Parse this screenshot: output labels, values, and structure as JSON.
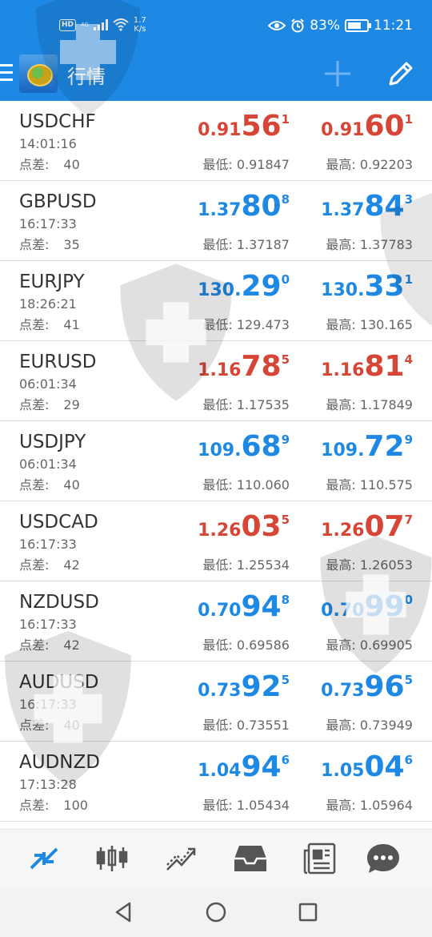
{
  "status_bar": {
    "hd": "HD",
    "network": "4G",
    "speed": "1.7",
    "speed_unit": "K/s",
    "battery": "83%",
    "time": "11:21"
  },
  "app_bar": {
    "title": "行情",
    "menu_icon": "menu-icon",
    "add_icon": "plus-icon",
    "edit_icon": "pencil-icon"
  },
  "quotes": [
    {
      "symbol": "USDCHF",
      "time": "14:01:16",
      "spread_label": "点差:",
      "spread": "40",
      "color": "red",
      "bid": {
        "pre": "0.91",
        "big": "56",
        "sup": "1"
      },
      "ask": {
        "pre": "0.91",
        "big": "60",
        "sup": "1"
      },
      "low": "最低: 0.91847",
      "high": "最高: 0.92203"
    },
    {
      "symbol": "GBPUSD",
      "time": "16:17:33",
      "spread_label": "点差:",
      "spread": "35",
      "color": "blue",
      "bid": {
        "pre": "1.37",
        "big": "80",
        "sup": "8"
      },
      "ask": {
        "pre": "1.37",
        "big": "84",
        "sup": "3"
      },
      "low": "最低: 1.37187",
      "high": "最高: 1.37783"
    },
    {
      "symbol": "EURJPY",
      "time": "18:26:21",
      "spread_label": "点差:",
      "spread": "41",
      "color": "blue",
      "bid": {
        "pre": "130.",
        "big": "29",
        "sup": "0"
      },
      "ask": {
        "pre": "130.",
        "big": "33",
        "sup": "1"
      },
      "low": "最低: 129.473",
      "high": "最高: 130.165"
    },
    {
      "symbol": "EURUSD",
      "time": "06:01:34",
      "spread_label": "点差:",
      "spread": "29",
      "color": "red",
      "bid": {
        "pre": "1.16",
        "big": "78",
        "sup": "5"
      },
      "ask": {
        "pre": "1.16",
        "big": "81",
        "sup": "4"
      },
      "low": "最低: 1.17535",
      "high": "最高: 1.17849"
    },
    {
      "symbol": "USDJPY",
      "time": "06:01:34",
      "spread_label": "点差:",
      "spread": "40",
      "color": "blue",
      "bid": {
        "pre": "109.",
        "big": "68",
        "sup": "9"
      },
      "ask": {
        "pre": "109.",
        "big": "72",
        "sup": "9"
      },
      "low": "最低: 110.060",
      "high": "最高: 110.575"
    },
    {
      "symbol": "USDCAD",
      "time": "16:17:33",
      "spread_label": "点差:",
      "spread": "42",
      "color": "red",
      "bid": {
        "pre": "1.26",
        "big": "03",
        "sup": "5"
      },
      "ask": {
        "pre": "1.26",
        "big": "07",
        "sup": "7"
      },
      "low": "最低: 1.25534",
      "high": "最高: 1.26053"
    },
    {
      "symbol": "NZDUSD",
      "time": "16:17:33",
      "spread_label": "点差:",
      "spread": "42",
      "color": "blue",
      "bid": {
        "pre": "0.70",
        "big": "94",
        "sup": "8"
      },
      "ask": {
        "pre": "0.70",
        "big": "99",
        "sup": "0"
      },
      "low": "最低: 0.69586",
      "high": "最高: 0.69905"
    },
    {
      "symbol": "AUDUSD",
      "time": "16:17:33",
      "spread_label": "点差:",
      "spread": "40",
      "color": "blue",
      "bid": {
        "pre": "0.73",
        "big": "92",
        "sup": "5"
      },
      "ask": {
        "pre": "0.73",
        "big": "96",
        "sup": "5"
      },
      "low": "最低: 0.73551",
      "high": "最高: 0.73949"
    },
    {
      "symbol": "AUDNZD",
      "time": "17:13:28",
      "spread_label": "点差:",
      "spread": "100",
      "color": "blue",
      "bid": {
        "pre": "1.04",
        "big": "94",
        "sup": "6"
      },
      "ask": {
        "pre": "1.05",
        "big": "04",
        "sup": "6"
      },
      "low": "最低: 1.05434",
      "high": "最高: 1.05964"
    }
  ],
  "bottom_nav": [
    "quotes-icon",
    "chart-icon",
    "trade-icon",
    "history-icon",
    "news-icon",
    "messages-icon"
  ],
  "colors": {
    "accent": "#1e88e5",
    "down": "#d64535",
    "up": "#1e88e5"
  }
}
